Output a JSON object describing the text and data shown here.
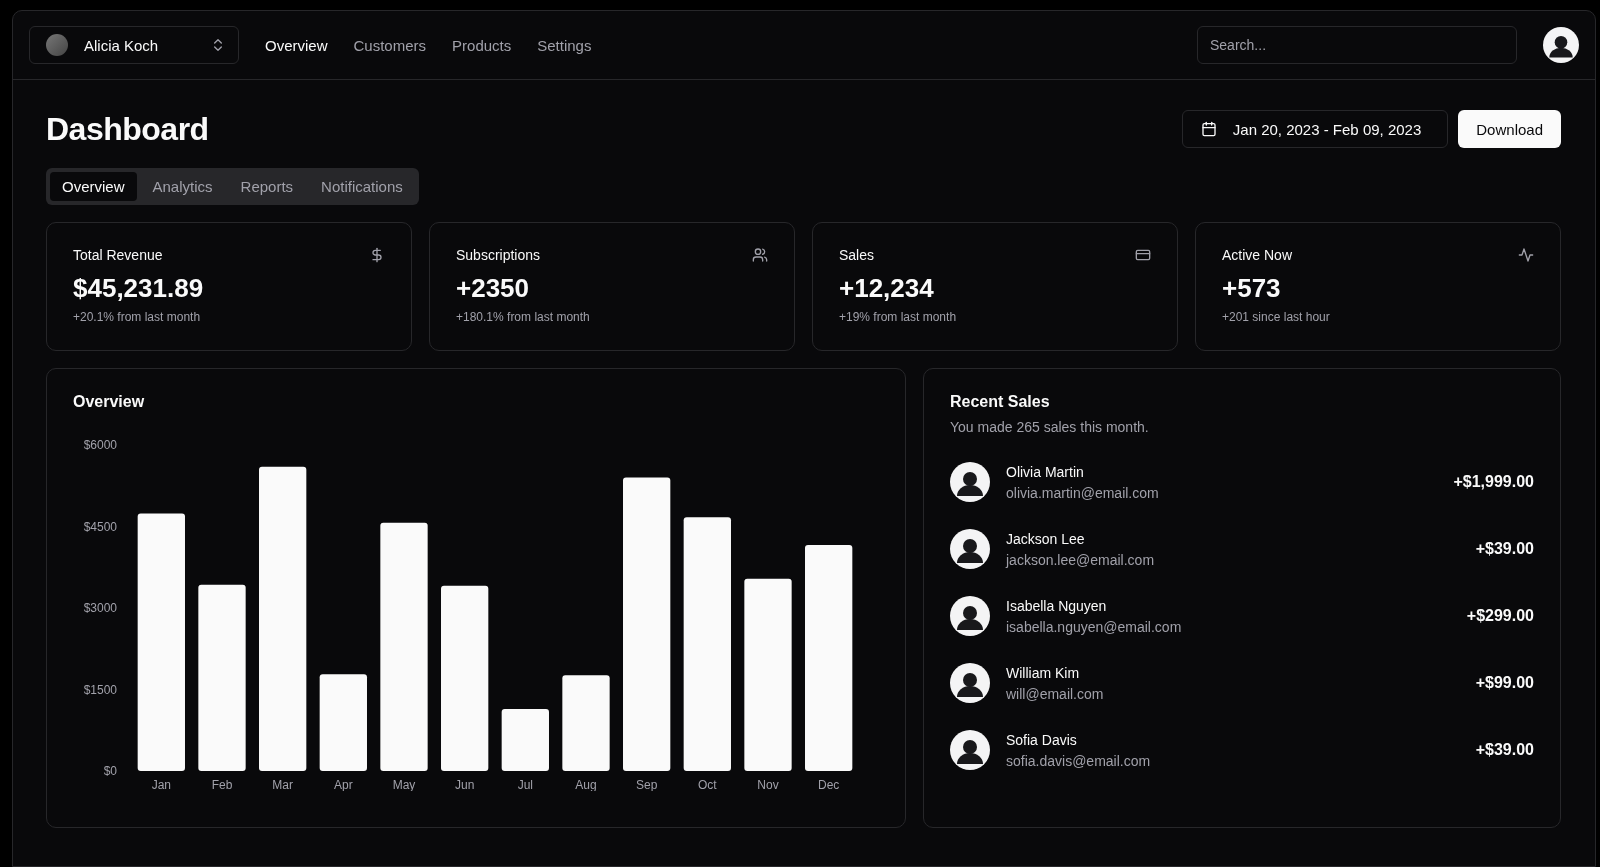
{
  "team_switcher": {
    "name": "Alicia Koch"
  },
  "nav": [
    {
      "label": "Overview",
      "selected": true
    },
    {
      "label": "Customers",
      "selected": false
    },
    {
      "label": "Products",
      "selected": false
    },
    {
      "label": "Settings",
      "selected": false
    }
  ],
  "search": {
    "placeholder": "Search..."
  },
  "page_title": "Dashboard",
  "date_range": "Jan 20, 2023 - Feb 09, 2023",
  "download_button": "Download",
  "tabs": [
    {
      "label": "Overview",
      "selected": true
    },
    {
      "label": "Analytics",
      "selected": false
    },
    {
      "label": "Reports",
      "selected": false
    },
    {
      "label": "Notifications",
      "selected": false
    }
  ],
  "stats": [
    {
      "title": "Total Revenue",
      "kind": "dollar",
      "value": "$45,231.89",
      "note": "+20.1% from last month"
    },
    {
      "title": "Subscriptions",
      "kind": "users",
      "value": "+2350",
      "note": "+180.1% from last month"
    },
    {
      "title": "Sales",
      "kind": "card",
      "value": "+12,234",
      "note": "+19% from last month"
    },
    {
      "title": "Active Now",
      "kind": "activity",
      "value": "+573",
      "note": "+201 since last hour"
    }
  ],
  "overview": {
    "title": "Overview",
    "chart_data": {
      "type": "bar",
      "categories": [
        "Jan",
        "Feb",
        "Mar",
        "Apr",
        "May",
        "Jun",
        "Jul",
        "Aug",
        "Sep",
        "Oct",
        "Nov",
        "Dec"
      ],
      "values": [
        4740,
        3430,
        5600,
        1780,
        4570,
        3410,
        1140,
        1760,
        5400,
        4670,
        3540,
        4160
      ],
      "ylim": [
        0,
        6000
      ],
      "yticks": [
        {
          "value": 0,
          "label": "$0"
        },
        {
          "value": 1500,
          "label": "$1500"
        },
        {
          "value": 3000,
          "label": "$3000"
        },
        {
          "value": 4500,
          "label": "$4500"
        },
        {
          "value": 6000,
          "label": "$6000"
        }
      ]
    }
  },
  "recent_sales": {
    "title": "Recent Sales",
    "subtitle": "You made 265 sales this month.",
    "items": [
      {
        "name": "Olivia Martin",
        "email": "olivia.martin@email.com",
        "amount": "+$1,999.00"
      },
      {
        "name": "Jackson Lee",
        "email": "jackson.lee@email.com",
        "amount": "+$39.00"
      },
      {
        "name": "Isabella Nguyen",
        "email": "isabella.nguyen@email.com",
        "amount": "+$299.00"
      },
      {
        "name": "William Kim",
        "email": "will@email.com",
        "amount": "+$99.00"
      },
      {
        "name": "Sofia Davis",
        "email": "sofia.davis@email.com",
        "amount": "+$39.00"
      }
    ]
  }
}
